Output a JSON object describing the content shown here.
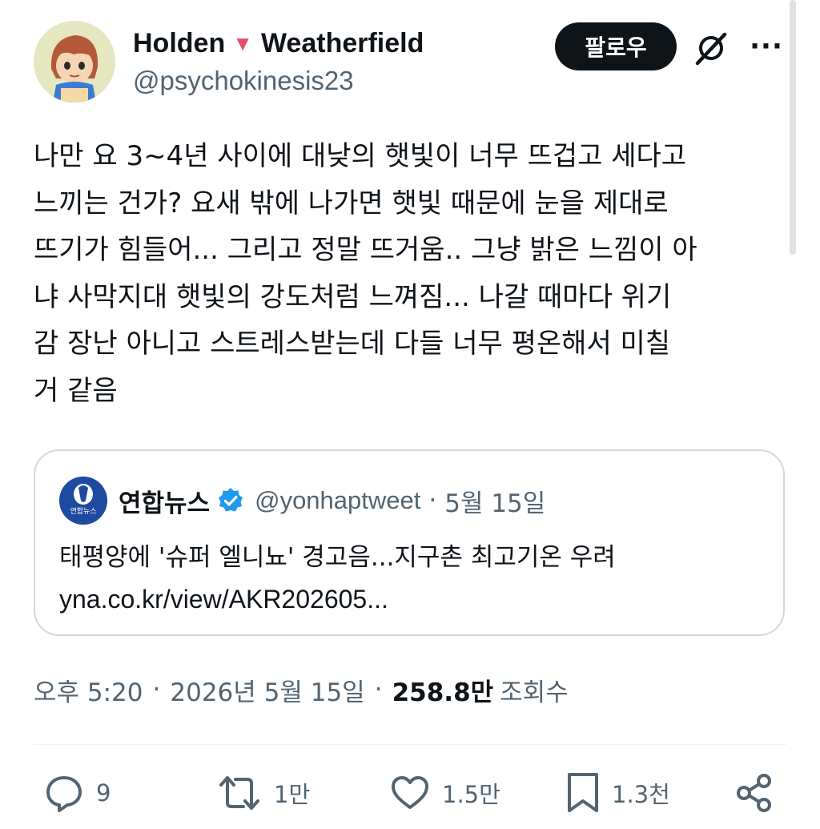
{
  "author": {
    "display_name_first": "Holden",
    "display_name_emoji": "🔻",
    "display_name_last": "Weatherfield",
    "handle": "@psychokinesis23"
  },
  "header_actions": {
    "follow_label": "팔로우",
    "grok_icon": "grok-icon",
    "more_label": "···"
  },
  "tweet": {
    "text": "나만 요 3~4년 사이에 대낮의 햇빛이 너무 뜨겁고 세다고\n느끼는 건가? 요새 밖에 나가면 햇빛 때문에 눈을 제대로\n뜨기가 힘들어... 그리고 정말 뜨거움.. 그냥 밝은 느낌이 아\n냐 사막지대 햇빛의 강도처럼 느껴짐... 나갈 때마다 위기\n감 장난 아니고 스트레스받는데 다들 너무 평온해서 미칠\n거 같음"
  },
  "quote": {
    "avatar_text": "연합뉴스",
    "name": "연합뉴스",
    "verified_icon": "verified-badge-icon",
    "handle": "@yonhaptweet",
    "separator": "·",
    "date": "5월 15일",
    "text": "태평양에 '슈퍼 엘니뇨' 경고음...지구촌 최고기온 우려",
    "link": "yna.co.kr/view/AKR202605..."
  },
  "meta": {
    "time": "오후 5:20",
    "separator": "·",
    "date": "2026년 5월 15일",
    "views_count": "258.8만",
    "views_label": "조회수"
  },
  "actions": {
    "reply": {
      "icon": "reply-icon",
      "count": "9"
    },
    "retweet": {
      "icon": "retweet-icon",
      "count": "1만"
    },
    "like": {
      "icon": "heart-icon",
      "count": "1.5만"
    },
    "bookmark": {
      "icon": "bookmark-icon",
      "count": "1.3천"
    },
    "share": {
      "icon": "share-icon"
    }
  },
  "colors": {
    "text_primary": "#0f1419",
    "text_secondary": "#536471",
    "border": "#cfd9de",
    "verified": "#1d9bf0",
    "emoji_red": "#e0506c"
  }
}
